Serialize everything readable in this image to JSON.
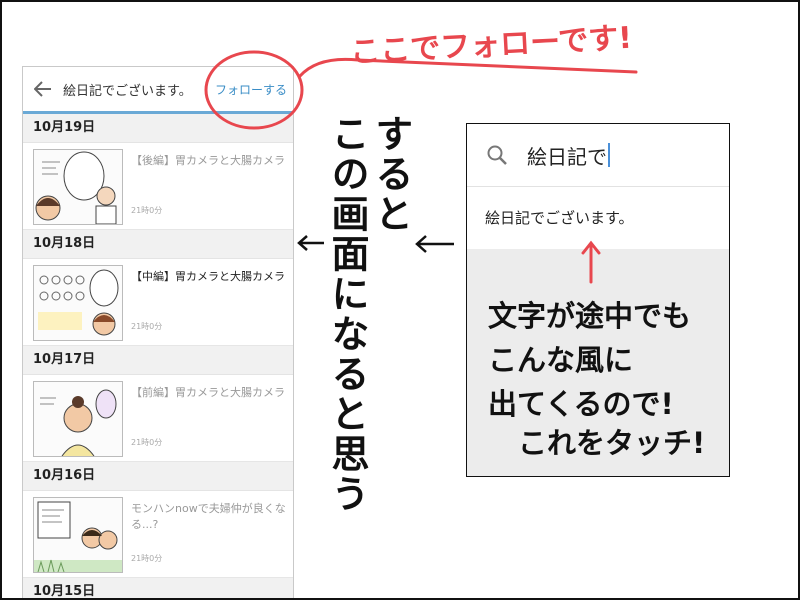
{
  "annotations": {
    "follow_note": "ここでフォローです!",
    "vertical_line1": "すると",
    "vertical_line2": "この画面になると思う",
    "search_note_lines": [
      "文字が途中でも",
      "こんな風に",
      "出てくるので!"
    ],
    "touch_note": "これをタッチ!"
  },
  "phone": {
    "title": "絵日記でございます。",
    "follow_label": "フォローする",
    "entries": [
      {
        "date": "10月19日",
        "title": "【後編】胃カメラと大腸カメラ",
        "time": "21時0分"
      },
      {
        "date": "10月18日",
        "title": "【中編】胃カメラと大腸カメラ",
        "time": "21時0分"
      },
      {
        "date": "10月17日",
        "title": "【前編】胃カメラと大腸カメラ",
        "time": "21時0分"
      },
      {
        "date": "10月16日",
        "title": "モンハンnowで夫婦仲が良くなる...?",
        "time": "21時0分"
      },
      {
        "date": "10月15日"
      }
    ]
  },
  "search": {
    "query": "絵日記で",
    "suggestion": "絵日記でございます。"
  },
  "colors": {
    "accent": "#3a8dc6",
    "annotation_red": "#e8474e",
    "appbar_line": "#6aa9d6"
  }
}
